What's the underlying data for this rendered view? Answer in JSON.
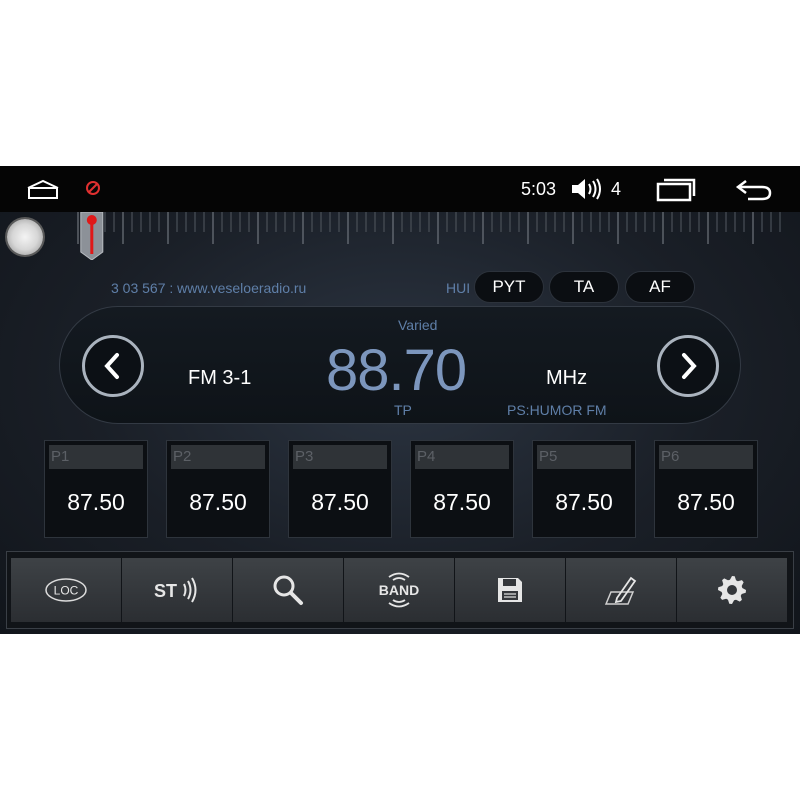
{
  "status_bar": {
    "time": "5:03",
    "volume_level": "4",
    "icons": [
      "home-icon",
      "block-icon",
      "volume-icon",
      "recents-icon",
      "back-icon"
    ]
  },
  "rds": {
    "radiotext": "3 03 567 : www.veseloeradio.ru",
    "hui_label": "HUI",
    "buttons": [
      "PYT",
      "TA",
      "AF"
    ]
  },
  "tuner": {
    "program_type": "Varied",
    "band": "FM 3-1",
    "frequency": "88.70",
    "unit": "MHz",
    "tp": "TP",
    "ps": "PS:HUMOR FM",
    "scale_position": 0.02
  },
  "presets": [
    {
      "label": "P1",
      "freq": "87.50"
    },
    {
      "label": "P2",
      "freq": "87.50"
    },
    {
      "label": "P3",
      "freq": "87.50"
    },
    {
      "label": "P4",
      "freq": "87.50"
    },
    {
      "label": "P5",
      "freq": "87.50"
    },
    {
      "label": "P6",
      "freq": "87.50"
    }
  ],
  "toolbar": {
    "loc_label": "LOC",
    "st_label": "ST",
    "band_label": "BAND",
    "icons": [
      "loc-icon",
      "stereo-icon",
      "search-icon",
      "band-icon",
      "save-icon",
      "edit-icon",
      "gear-icon"
    ]
  },
  "colors": {
    "accent_blue": "#7c96bd",
    "needle_red": "#e01818",
    "background": "#1a1f27"
  }
}
